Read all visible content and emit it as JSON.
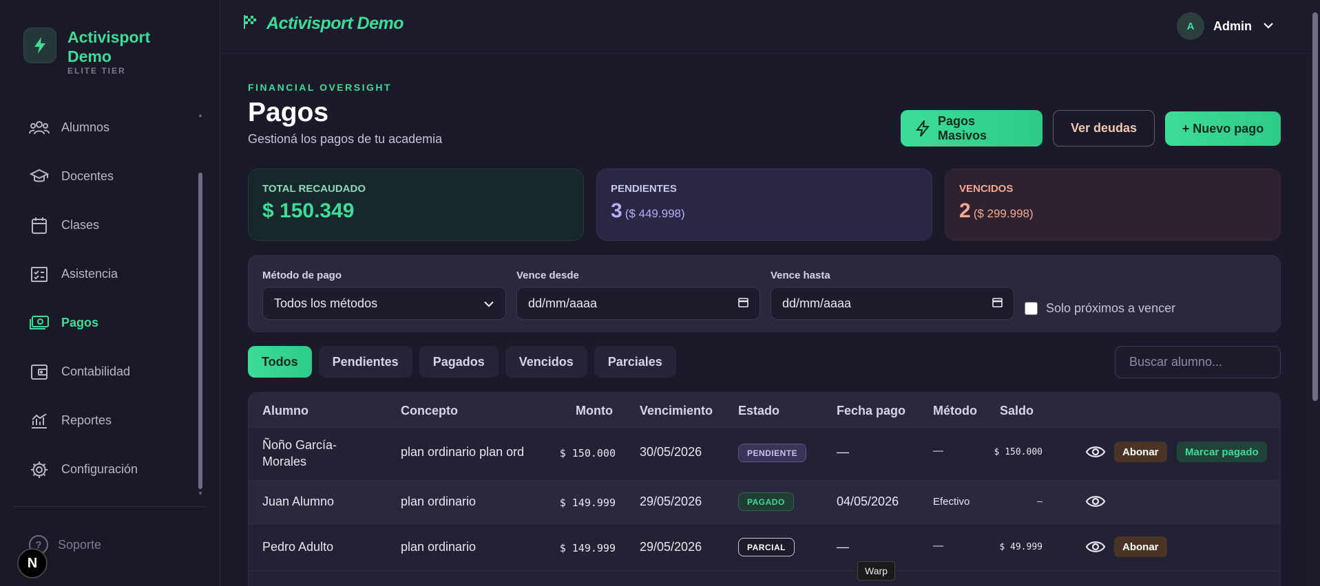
{
  "brand": {
    "name": "Activisport Demo",
    "tier": "ELITE TIER"
  },
  "sidebar": {
    "items": [
      {
        "label": "Alumnos",
        "icon": "users-icon"
      },
      {
        "label": "Docentes",
        "icon": "graduation-cap-icon"
      },
      {
        "label": "Clases",
        "icon": "calendar-icon"
      },
      {
        "label": "Asistencia",
        "icon": "checklist-icon"
      },
      {
        "label": "Pagos",
        "icon": "cash-icon",
        "active": true
      },
      {
        "label": "Contabilidad",
        "icon": "wallet-icon"
      },
      {
        "label": "Reportes",
        "icon": "chart-icon"
      },
      {
        "label": "Configuración",
        "icon": "gear-icon"
      }
    ],
    "support": "Soporte",
    "badge": "N"
  },
  "topbar": {
    "title": "Activisport Demo",
    "user_initial": "A",
    "user_name": "Admin"
  },
  "page": {
    "eyebrow": "FINANCIAL OVERSIGHT",
    "title": "Pagos",
    "subtitle": "Gestioná los pagos de tu academia"
  },
  "actions": {
    "masivos": "Pagos Masivos",
    "deudas": "Ver deudas",
    "nuevo": "+ Nuevo pago"
  },
  "stats": {
    "total": {
      "label": "TOTAL RECAUDADO",
      "value": "$ 150.349"
    },
    "pendientes": {
      "label": "PENDIENTES",
      "value": "3",
      "sub": "($ 449.998)"
    },
    "vencidos": {
      "label": "VENCIDOS",
      "value": "2",
      "sub": "($ 299.998)"
    }
  },
  "filters": {
    "metodo_label": "Método de pago",
    "metodo_value": "Todos los métodos",
    "desde_label": "Vence desde",
    "desde_value": "dd/mm/aaaa",
    "hasta_label": "Vence hasta",
    "hasta_value": "dd/mm/aaaa",
    "proximos": "Solo próximos a vencer"
  },
  "tabs": [
    "Todos",
    "Pendientes",
    "Pagados",
    "Vencidos",
    "Parciales"
  ],
  "search_placeholder": "Buscar alumno...",
  "table": {
    "headers": [
      "Alumno",
      "Concepto",
      "Monto",
      "Vencimiento",
      "Estado",
      "Fecha pago",
      "Método",
      "Saldo"
    ],
    "rows": [
      {
        "alumno": "Ñoño García-Morales",
        "concepto": "plan ordinario plan ord",
        "monto": "$ 150.000",
        "vencimiento": "30/05/2026",
        "estado": "PENDIENTE",
        "fecha_pago": "—",
        "metodo": "—",
        "saldo": "$ 150.000",
        "abonar": "Abonar",
        "marcar": "Marcar pagado"
      },
      {
        "alumno": "Juan Alumno",
        "concepto": "plan ordinario",
        "monto": "$ 149.999",
        "vencimiento": "29/05/2026",
        "estado": "PAGADO",
        "fecha_pago": "04/05/2026",
        "metodo": "Efectivo",
        "saldo": "–"
      },
      {
        "alumno": "Pedro Adulto",
        "concepto": "plan ordinario",
        "monto": "$ 149.999",
        "vencimiento": "29/05/2026",
        "estado": "PARCIAL",
        "fecha_pago": "—",
        "metodo": "—",
        "saldo": "$ 49.999",
        "abonar": "Abonar"
      }
    ]
  },
  "tooltip": "Warp",
  "colors": {
    "accent": "#3ddc97",
    "background": "#1b1a2b",
    "pending": "#b3aef5",
    "overdue": "#f5a88f"
  }
}
